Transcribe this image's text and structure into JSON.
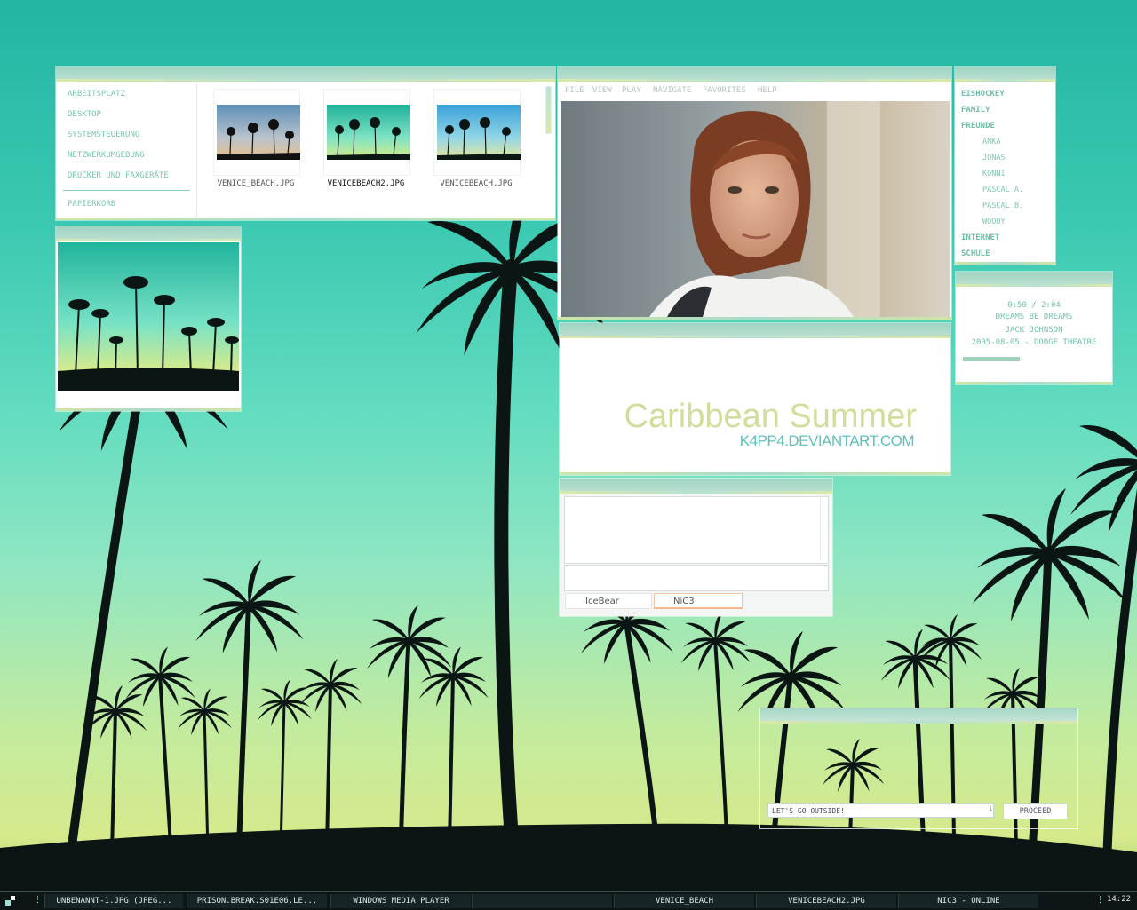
{
  "explorer": {
    "nav": [
      "ARBEITSPLATZ",
      "DESKTOP",
      "SYSTEMSTEUERUNG",
      "NETZWERKUMGEBUNG",
      "DRUCKER UND FAXGERÄTE"
    ],
    "trash": "PAPIERKORB",
    "files": [
      "VENICE_BEACH.JPG",
      "VENICEBEACH2.JPG",
      "VENICEBEACH.JPG"
    ]
  },
  "media_player": {
    "menu": [
      "FILE",
      "VIEW",
      "PLAY",
      "NAVIGATE",
      "FAVORITES",
      "HELP"
    ]
  },
  "favorites": {
    "groups_top": [
      "EISHOCKEY",
      "FAMILY",
      "FREUNDE"
    ],
    "friends": [
      "ANKA",
      "JONAS",
      "KONNI",
      "PASCAL A.",
      "PASCAL B.",
      "WOODY"
    ],
    "groups_bottom": [
      "INTERNET",
      "SCHULE"
    ]
  },
  "now_playing": {
    "time": "0:50 / 2:04",
    "track": "DREAMS BE DREAMS",
    "artist": "JACK JOHNSON",
    "venue": "2005-08-05 - DODGE THEATRE",
    "progress": 0.4
  },
  "banner": {
    "title": "Caribbean Summer",
    "subtitle": "K4PP4.DEVIANTART.COM"
  },
  "chat": {
    "tabs": [
      "IceBear",
      "NiC3"
    ]
  },
  "search": {
    "value": "LET'S GO OUTSIDE!",
    "button": "PROCEED"
  },
  "taskbar": {
    "tasks": [
      "UNBENANNT-1.JPG (JPEG...",
      "PRISON.BREAK.S01E06.LE...",
      "WINDOWS MEDIA PLAYER",
      "",
      "VENICE_BEACH",
      "VENICEBEACH2.JPG",
      "NIC3 - ONLINE"
    ],
    "clock": "14:22"
  },
  "colors": {
    "accent": "#6fbfab",
    "title_bar": "#b9ded0",
    "banner_title": "#d4dc9b",
    "banner_subtitle": "#5fc2b8"
  }
}
